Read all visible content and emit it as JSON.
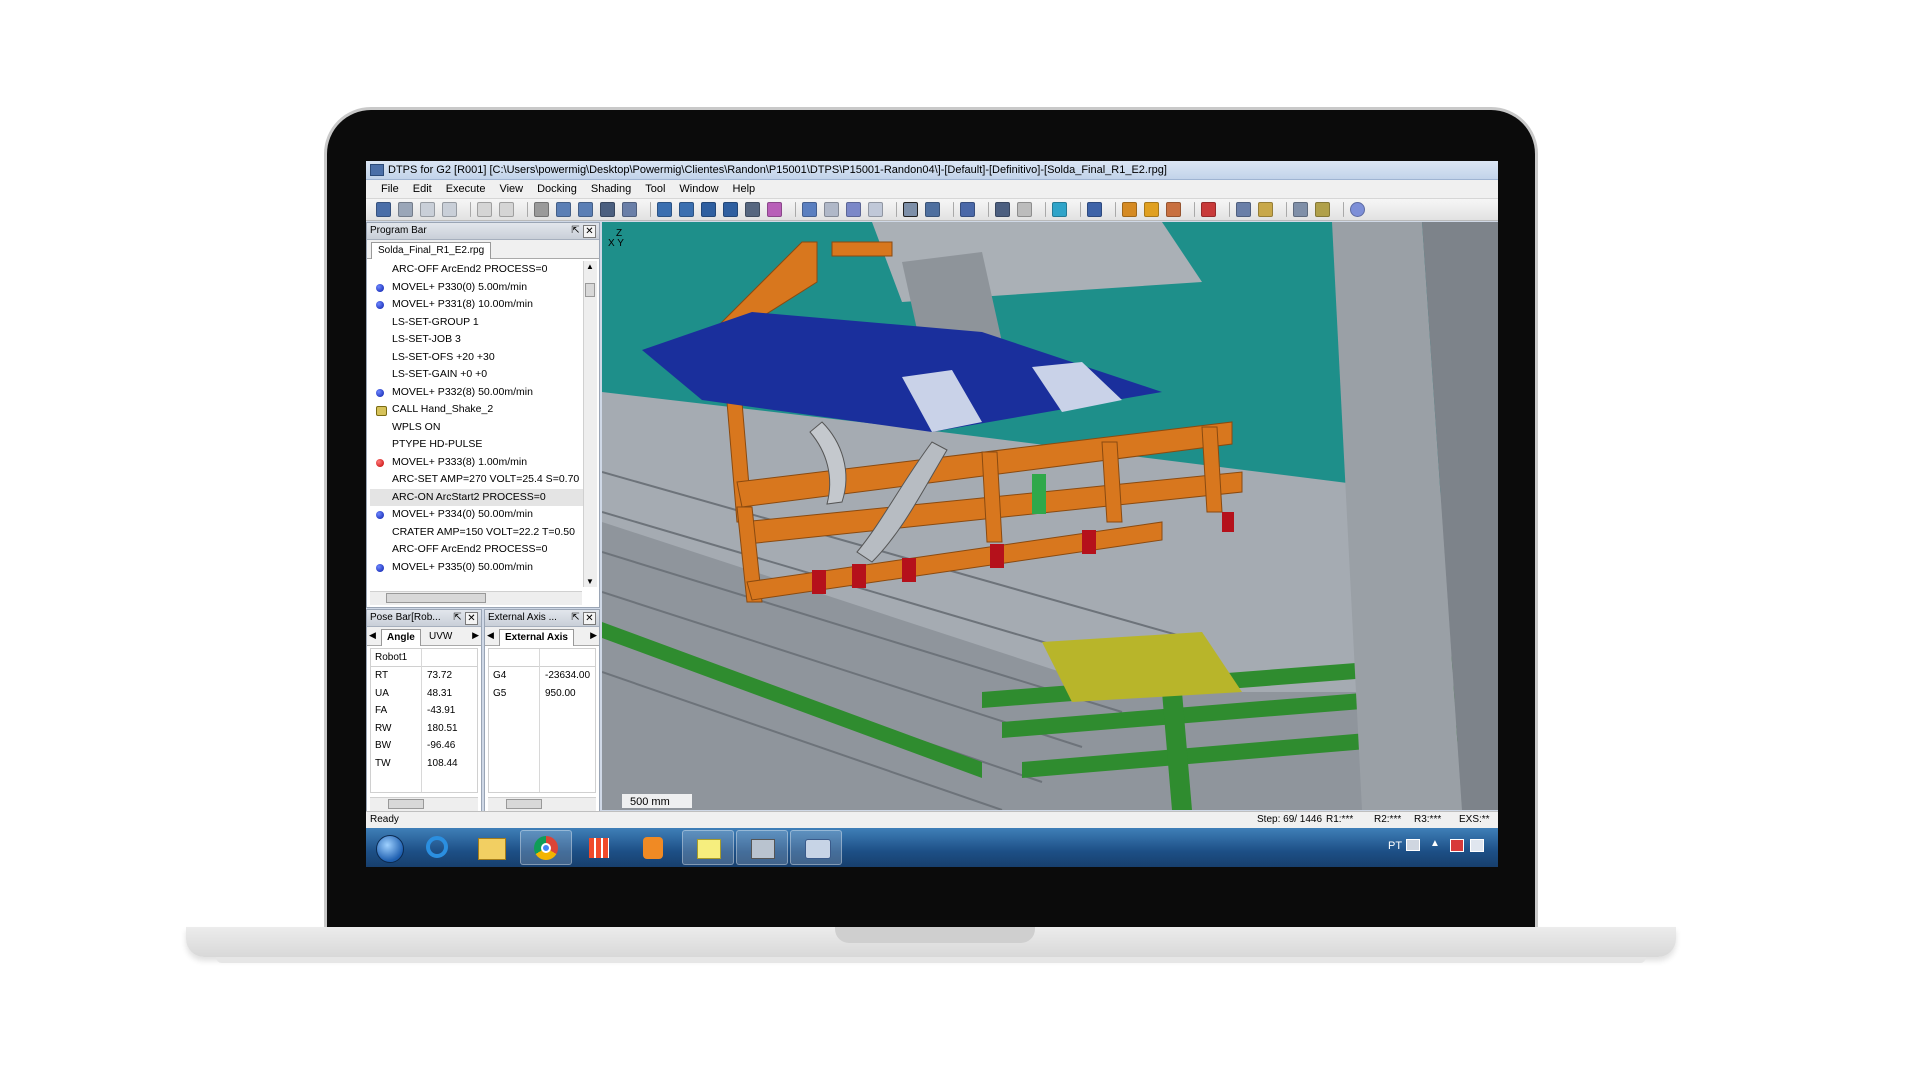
{
  "window": {
    "title": "DTPS for G2 [R001] [C:\\Users\\powermig\\Desktop\\Powermig\\Clientes\\Randon\\P15001\\DTPS\\P15001-Randon04\\]-[Default]-[Definitivo]-[Solda_Final_R1_E2.rpg]"
  },
  "menu": [
    "File",
    "Edit",
    "Execute",
    "View",
    "Docking",
    "Shading",
    "Tool",
    "Window",
    "Help"
  ],
  "program_bar": {
    "title": "Program Bar",
    "tab": "Solda_Final_R1_E2.rpg",
    "lines": [
      {
        "text": "ARC-OFF ArcEnd2 PROCESS=0",
        "marker": ""
      },
      {
        "text": "MOVEL+ P330(0) 5.00m/min",
        "marker": "blue"
      },
      {
        "text": "MOVEL+ P331(8) 10.00m/min",
        "marker": "blue"
      },
      {
        "text": "LS-SET-GROUP 1",
        "marker": ""
      },
      {
        "text": "LS-SET-JOB 3",
        "marker": ""
      },
      {
        "text": "LS-SET-OFS +20 +30",
        "marker": ""
      },
      {
        "text": "LS-SET-GAIN +0 +0",
        "marker": ""
      },
      {
        "text": "MOVEL+ P332(8) 50.00m/min",
        "marker": "blue"
      },
      {
        "text": "CALL Hand_Shake_2",
        "marker": "call"
      },
      {
        "text": "WPLS ON",
        "marker": ""
      },
      {
        "text": "PTYPE HD-PULSE",
        "marker": ""
      },
      {
        "text": "MOVEL+ P333(8) 1.00m/min",
        "marker": "red"
      },
      {
        "text": "ARC-SET AMP=270 VOLT=25.4 S=0.70",
        "marker": ""
      },
      {
        "text": "ARC-ON ArcStart2 PROCESS=0",
        "marker": "",
        "highlight": true
      },
      {
        "text": "MOVEL+ P334(0) 50.00m/min",
        "marker": "blue"
      },
      {
        "text": "CRATER AMP=150 VOLT=22.2 T=0.50",
        "marker": ""
      },
      {
        "text": "ARC-OFF ArcEnd2 PROCESS=0",
        "marker": ""
      },
      {
        "text": "MOVEL+ P335(0) 50.00m/min",
        "marker": "blue"
      }
    ]
  },
  "pose_bar": {
    "title": "Pose Bar[Rob...",
    "tab_active": "Angle",
    "tab_other": "UVW",
    "header": "Robot1",
    "rows": [
      {
        "k": "RT",
        "v": "73.72"
      },
      {
        "k": "UA",
        "v": "48.31"
      },
      {
        "k": "FA",
        "v": "-43.91"
      },
      {
        "k": "RW",
        "v": "180.51"
      },
      {
        "k": "BW",
        "v": "-96.46"
      },
      {
        "k": "TW",
        "v": "108.44"
      }
    ]
  },
  "external_axis": {
    "title": "External Axis ...",
    "tab_active": "External Axis",
    "rows": [
      {
        "k": "G4",
        "v": "-23634.00"
      },
      {
        "k": "G5",
        "v": "950.00"
      }
    ]
  },
  "viewport": {
    "axis_z": "Z",
    "axis_xy": "X Y",
    "scale_label": "500 mm",
    "colors": {
      "background": "#1e8f8a",
      "frame": "#d8771e",
      "canopy": "#1a2f9c",
      "floor": "#9aa0a6",
      "rails": "#2e8b2e"
    }
  },
  "status": {
    "ready": "Ready",
    "step": "Step:  69/ 1446",
    "r1": "R1:***",
    "r2": "R2:***",
    "r3": "R3:***",
    "exs": "EXS:**"
  },
  "taskbar": {
    "lang": "PT",
    "icons": [
      "start-orb-icon",
      "internet-explorer-icon",
      "file-explorer-icon",
      "chrome-icon",
      "apps-grid-icon",
      "media-player-icon",
      "sticky-notes-icon",
      "robot-app-icon",
      "dtps-app-icon"
    ]
  }
}
